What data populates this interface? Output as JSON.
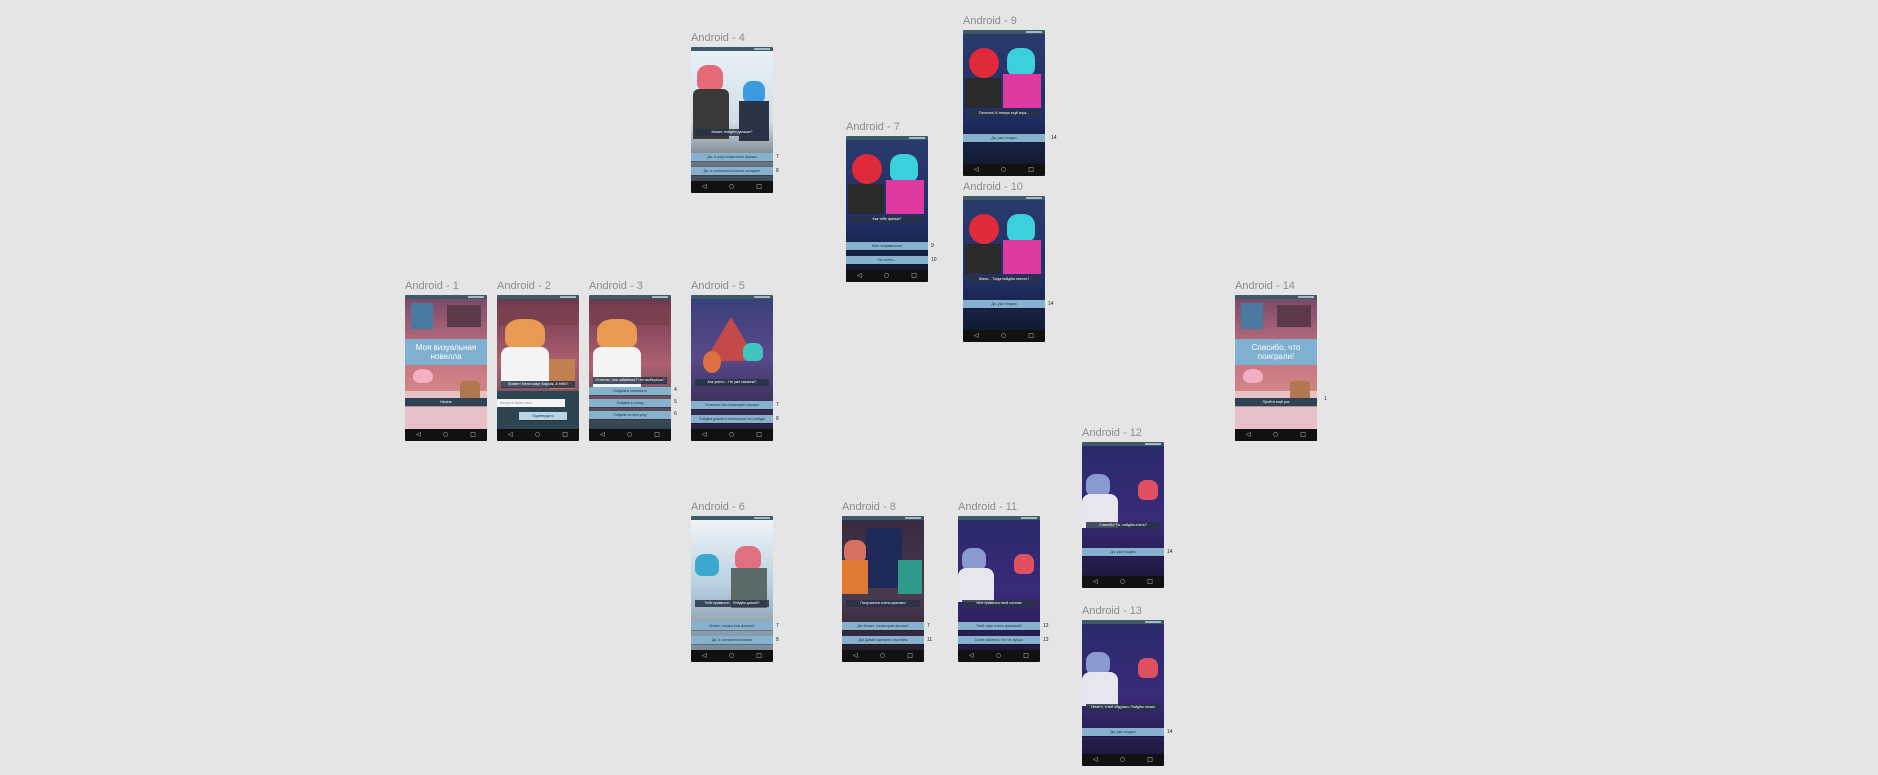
{
  "canvas_bg": "#e5e5e5",
  "frames": {
    "f1": {
      "title": "Android - 1",
      "heading": "Моя визуальная новелла",
      "button": "Начать"
    },
    "f2": {
      "title": "Android - 2",
      "dialog": "Привет! Меня зовут Барсик. А тебя?",
      "placeholder": "Введите Ваше имя",
      "submit": "Подтвердить"
    },
    "f3": {
      "title": "Android - 3",
      "dialog": "Отлично, чем займёмся? Что выберешь?",
      "choices": [
        "Пойдём в кинотеатр",
        "Пойдём в поход",
        "Пойдём на прогулку"
      ],
      "links": [
        "4",
        "5",
        "6"
      ]
    },
    "f4": {
      "title": "Android - 4",
      "dialog": "Может, пойдём дальше?",
      "choices": [
        "Да, я хочу посмотреть фильм",
        "Да, я согласен/согласна посидеть"
      ],
      "links": [
        "7",
        "8"
      ]
    },
    "f5": {
      "title": "Android - 5",
      "dialog": "Как уютно... Не уже сможем?",
      "choices": [
        "Хотелось бы посмотреть фильм",
        "Пойдём домой и посмотрим что-нибудь"
      ],
      "links": [
        "7",
        "8"
      ]
    },
    "f6": {
      "title": "Android - 6",
      "dialog": "Тебе нравится... Пойдём домой?",
      "choices": [
        "Может, посмотрим фильм?",
        "Да, я согласен/согласна"
      ],
      "links": [
        "7",
        "8"
      ]
    },
    "f7": {
      "title": "Android - 7",
      "dialog": "Как тебе фильм?",
      "choices": [
        "Мне понравилось!",
        "Не очень..."
      ],
      "links": [
        "9",
        "10"
      ]
    },
    "f8": {
      "title": "Android - 8",
      "dialog": "Получается очень красиво!",
      "choices": [
        "Да! Может, посмотрим фильм?",
        "Да! Давай сделаем почитаем"
      ],
      "links": [
        "7",
        "11"
      ]
    },
    "f9": {
      "title": "Android - 9",
      "dialog": "Отлично! А теперь ещё игра...",
      "choices": [
        "Да, уже поздно"
      ],
      "links": [
        "14"
      ]
    },
    "f10": {
      "title": "Android - 10",
      "dialog": "Жаль... Тогда пойдём поесть?",
      "choices": [
        "Да, уже поздно"
      ],
      "links": [
        "14"
      ]
    },
    "f11": {
      "title": "Android - 11",
      "dialog": "Мне нравится твой костюм",
      "choices": [
        "Твой тоже очень красивый!",
        "А мне кажется, что он лучше"
      ],
      "links": [
        "12",
        "13"
      ]
    },
    "f12": {
      "title": "Android - 12",
      "dialog": "Спасибо! Ты, пойдём спать?",
      "choices": [
        "Да, уже поздно"
      ],
      "links": [
        "14"
      ]
    },
    "f13": {
      "title": "Android - 13",
      "dialog": "Ничего, я всё обдумал. Пойдём ночью",
      "choices": [
        "Да, уже поздно"
      ],
      "links": [
        "14"
      ]
    },
    "f14": {
      "title": "Android - 14",
      "heading": "Спасибо, что поиграли!",
      "button": "Пройти ещё раз",
      "links": [
        "1"
      ]
    }
  },
  "nav": {
    "back": "◁",
    "home": "○",
    "recent": "□"
  },
  "colors": {
    "choice": "#86b2cf",
    "statusbar": "#3d5a66",
    "navbar": "#111111",
    "title_box": "#7fb0cf"
  }
}
